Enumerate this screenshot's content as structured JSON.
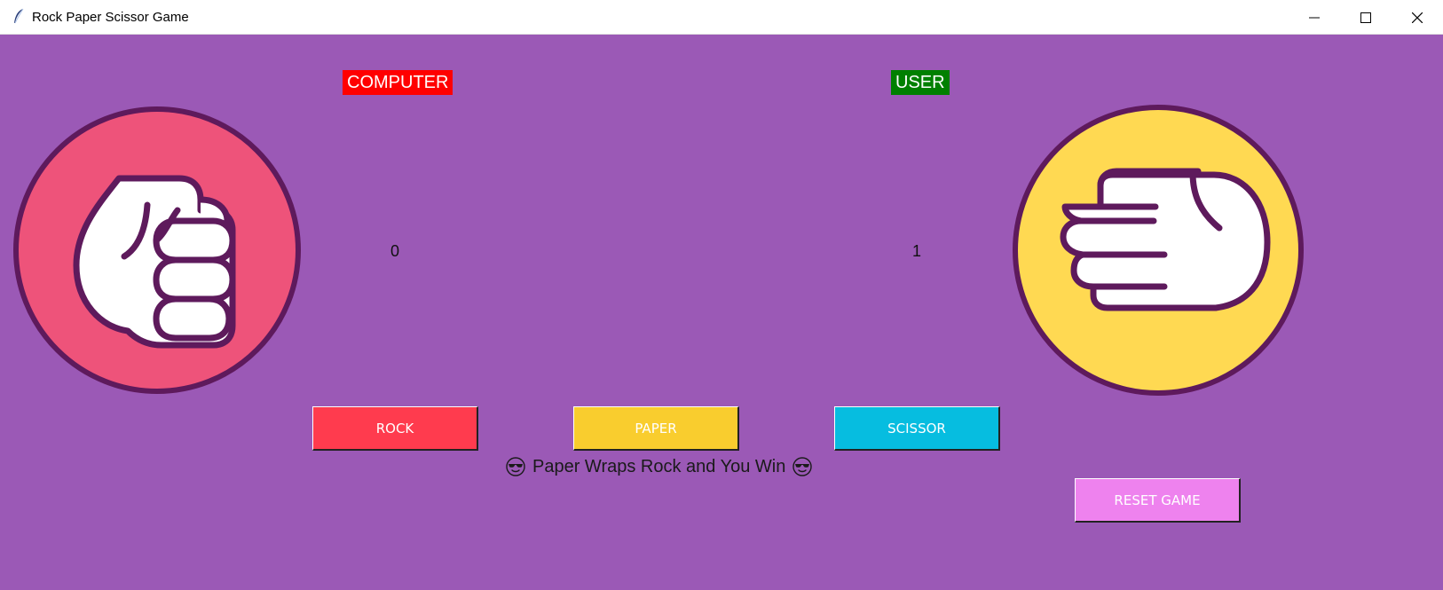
{
  "window": {
    "title": "Rock Paper Scissor Game",
    "icon": "feather-icon",
    "controls": [
      "minimize-icon",
      "maximize-icon",
      "close-icon"
    ]
  },
  "players": {
    "computer": {
      "label": "COMPUTER",
      "score": "0",
      "hand": "rock",
      "label_color": "#ff0000",
      "circle_color": "#ee537a"
    },
    "user": {
      "label": "USER",
      "score": "1",
      "hand": "paper",
      "label_color": "#008000",
      "circle_color": "#ffd952"
    }
  },
  "buttons": {
    "rock": {
      "label": "ROCK",
      "color": "#ff3b4e"
    },
    "paper": {
      "label": "PAPER",
      "color": "#f9cd2e"
    },
    "scissor": {
      "label": "SCISSOR",
      "color": "#06bde0"
    },
    "reset": {
      "label": "RESET GAME",
      "color": "#ee82ee"
    }
  },
  "result": {
    "text": "Paper Wraps Rock and You Win",
    "emoji": "sunglasses-emoji-icon"
  },
  "colors": {
    "background": "#9b59b6",
    "hand_outline": "#5e1a5c"
  }
}
